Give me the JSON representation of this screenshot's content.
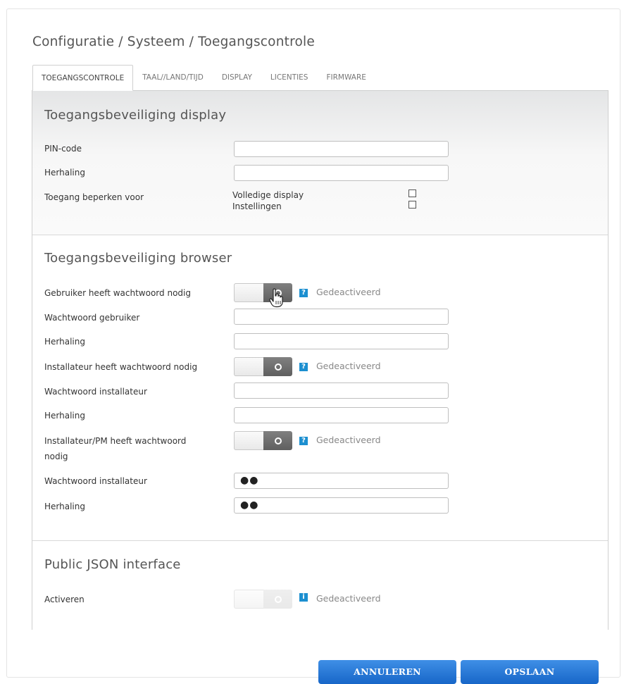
{
  "breadcrumb": "Configuratie / Systeem / Toegangscontrole",
  "tabs": [
    "TOEGANGSCONTROLE",
    "TAAL//LAND/TIJD",
    "DISPLAY",
    "LICENTIES",
    "FIRMWARE"
  ],
  "display_section": {
    "title": "Toegangsbeveiliging display",
    "pin_label": "PIN-code",
    "pin_value": "",
    "repeat_label": "Herhaling",
    "repeat_value": "",
    "restrict_label": "Toegang beperken voor",
    "options": [
      {
        "label": "Volledige display",
        "checked": false
      },
      {
        "label": "Instellingen",
        "checked": false
      }
    ]
  },
  "browser_section": {
    "title": "Toegangsbeveiliging browser",
    "user_pw_required_label": "Gebruiker heeft wachtwoord nodig",
    "user_pw_status": "Gedeactiveerd",
    "user_pw_label": "Wachtwoord gebruiker",
    "user_pw_value": "",
    "user_repeat_label": "Herhaling",
    "user_repeat_value": "",
    "installer_pw_required_label": "Installateur heeft wachtwoord nodig",
    "installer_pw_status": "Gedeactiveerd",
    "installer_pw_label": "Wachtwoord installateur",
    "installer_pw_value": "",
    "installer_repeat_label": "Herhaling",
    "installer_repeat_value": "",
    "pm_pw_required_label_line1": "Installateur/PM heeft wachtwoord",
    "pm_pw_required_label_line2": "nodig",
    "pm_pw_status": "Gedeactiveerd",
    "pm_pw_label": "Wachtwoord installateur",
    "pm_pw_value": "●●",
    "pm_repeat_label": "Herhaling",
    "pm_repeat_value": "●●"
  },
  "json_section": {
    "title": "Public JSON interface",
    "activate_label": "Activeren",
    "status": "Gedeactiveerd"
  },
  "buttons": {
    "cancel": "ANNULEREN",
    "save": "OPSLAAN"
  },
  "icons": {
    "help": "?",
    "info": "i"
  },
  "colors": {
    "accent": "#1c8fd0",
    "button": "#2a7ad9"
  }
}
